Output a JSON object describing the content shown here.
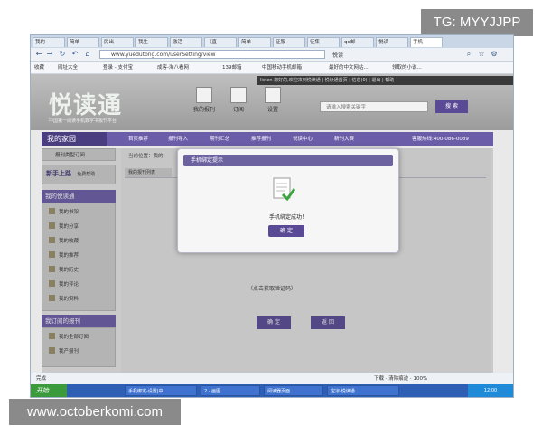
{
  "watermarks": {
    "top": "TG: MYYJJPP",
    "bottom": "www.octoberkomi.com"
  },
  "browser": {
    "tabs": [
      "我的",
      "简单",
      "民出",
      "我生",
      "激活",
      "《直",
      "简单",
      "征服",
      "征集",
      "qq邮",
      "悦读",
      "手机"
    ],
    "url": "www.yuedutong.com/userSetting/view",
    "search_label": "悦读",
    "bookmarks": [
      "收藏",
      "网址大全",
      "登录 - 支付宝",
      "成客-淘八看网",
      "139邮箱",
      "中国移动手机邮箱",
      "最好的中文网站...",
      "领取的小说..."
    ]
  },
  "site": {
    "logo": "悦读通",
    "logo_sub": "中国第一阅读手机数字书报刊平台",
    "top_strip": "listen 您好的,欢迎来到悦读通 | 悦读通首页 | 信息(0) | 退出 | 帮助",
    "header_icons": [
      "我的报刊",
      "订阅",
      "设置"
    ],
    "search_placeholder": "请输入搜索关键字",
    "search_button": "搜 索",
    "menu": {
      "home": "我的家园",
      "items": [
        "首页推荐",
        "报刊导入",
        "期刊汇总",
        "推荐报刊",
        "悦读中心",
        "新刊大赛"
      ],
      "hotline": "客服热线:400-086-0089"
    }
  },
  "sidebar": {
    "tag": "报刊类型订阅",
    "newbie": "新手上路",
    "newbie_sub": "免费帮助",
    "section1": "我的悦读通",
    "items1": [
      "我的书架",
      "我的分享",
      "我的收藏",
      "我的推荐",
      "我的历史",
      "我的评论",
      "我的资料"
    ],
    "section2": "我订阅的报刊",
    "items2": [
      "我的全部订阅",
      "我产报刊"
    ]
  },
  "content": {
    "breadcrumb": "当前位置：我的",
    "subtab": "我的报刊列表",
    "hint": "（点击获取验证码）",
    "ok_button": "确 定",
    "back_button": "返 回"
  },
  "modal": {
    "title": "手机绑定提示",
    "message": "手机绑定成功！",
    "ok": "确 定"
  },
  "status": {
    "left": "完成",
    "right": "下载 · 清除痕迹 · 100%"
  },
  "taskbar": {
    "start": "开始",
    "tasks": [
      "手机绑定-设置|中",
      "2 - 画图",
      "阅读器页面",
      "宝凉-悦读通"
    ],
    "clock": "12:00"
  }
}
